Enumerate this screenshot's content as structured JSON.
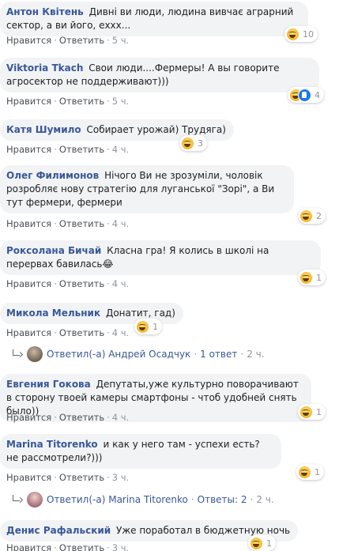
{
  "labels": {
    "like": "Нравится",
    "reply": "Ответить",
    "sep": "·"
  },
  "colors": {
    "author": "#385898",
    "bubble": "#f2f3f5",
    "link": "#4b4f56",
    "like_badge": "#1877f2",
    "haha_badge": "#f7b125"
  },
  "comments": [
    {
      "author": "Антон Квітень",
      "text": "Дивні ви люди, людина вивчає аграрний сектор, а ви його, ехxx...",
      "time": "5 ч.",
      "reaction_icons": [
        "haha-icon"
      ],
      "reaction_count": "10"
    },
    {
      "author": "Viktoria Tkach",
      "text": "Свои люди....Фермеры! А вы говорите агросектор не поддерживают)))",
      "time": "5 ч.",
      "reaction_icons": [
        "haha-icon",
        "like-icon"
      ],
      "reaction_count": "4"
    },
    {
      "author": "Катя Шумило",
      "text": "Собирает урожай) Трудяга)",
      "time": "4 ч.",
      "reaction_icons": [
        "haha-icon"
      ],
      "reaction_count": "3"
    },
    {
      "author": "Олег Филимонов",
      "text": "Нічого Ви не зрозуміли, чоловік розробляє нову стратегію для луганської \"Зорі\", а Ви тут фермери, фермери",
      "time": "4 ч.",
      "reaction_icons": [
        "haha-icon"
      ],
      "reaction_count": "2"
    },
    {
      "author": "Роксолана Бичай",
      "text": "Класна гра! Я колись в школі на перервах бавилась😂",
      "time": "4 ч.",
      "reaction_icons": [
        "haha-icon"
      ],
      "reaction_count": "1"
    },
    {
      "author": "Микола Мельник",
      "text": "Донатит, гад)",
      "time": "4 ч.",
      "reaction_icons": [
        "haha-icon"
      ],
      "reaction_count": "1"
    },
    {
      "author": "Евгения Гокова",
      "text": "Депутаты,уже культурно поворачивают в сторону твоей камеры смартфоны - чтоб удобней снять было))",
      "time": "4 ч.",
      "reaction_icons": [
        "haha-icon"
      ],
      "reaction_count": "1"
    },
    {
      "author": "Marina Titorenko",
      "text": "и как у него там - успехи есть? не рассмотрели?)))",
      "time": "3 ч.",
      "reaction_icons": [
        "haha-icon"
      ],
      "reaction_count": "1"
    },
    {
      "author": "Денис Рафальский",
      "text": "Уже поработал в бюджетную ночь",
      "time": "3 ч.",
      "reaction_icons": [
        "haha-icon"
      ],
      "reaction_count": "1"
    }
  ],
  "replies": [
    {
      "text": "Ответил(-а) Андрей Осадчук",
      "count": "1 ответ",
      "time": "2 ч."
    },
    {
      "text": "Ответил(-а) Marina Titorenko",
      "count": "Ответы: 2",
      "time": "2 ч."
    }
  ]
}
